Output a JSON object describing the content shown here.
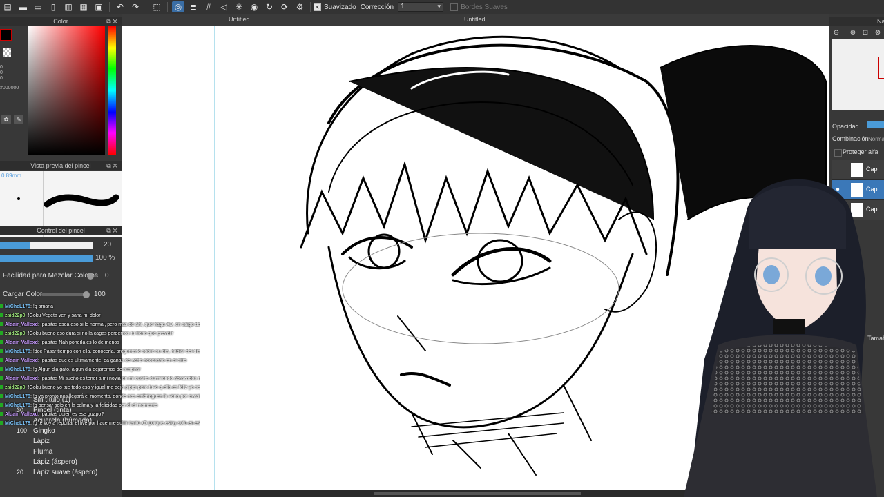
{
  "toolbar": {
    "smoothing_label": "Suavizado",
    "correction_label": "Corrección",
    "correction_value": "1",
    "soft_edges_label": "Bordes Suaves"
  },
  "tabs": {
    "left": "Untitled",
    "right": "Untitled"
  },
  "color_panel": {
    "title": "Color",
    "hex_value": "#000000",
    "channel_values": [
      "0",
      "0",
      "0"
    ],
    "fg_color": "#000000",
    "accent_color": "#cc0000"
  },
  "brush_preview": {
    "title": "Vista previa del pincel",
    "size": "0.89mm"
  },
  "brush_control": {
    "title": "Control del pincel",
    "size_value": "20",
    "opacity_value": "100 %",
    "size_fraction": 0.32,
    "opacity_fraction": 1.0,
    "mix_label": "Facilidad para Mezclar Colores",
    "mix_value": "0",
    "load_label": "Cargar Color",
    "load_value": "100"
  },
  "brush_list": [
    {
      "num": "",
      "label": "Sin título (1)"
    },
    {
      "num": "30",
      "label": "Pincel (tinta)"
    },
    {
      "num": "",
      "label": "Acuarela (húmeda)"
    },
    {
      "num": "100",
      "label": "Gingko"
    },
    {
      "num": "",
      "label": "Lápiz"
    },
    {
      "num": "",
      "label": "Pluma"
    },
    {
      "num": "",
      "label": "Lápiz (áspero)"
    },
    {
      "num": "20",
      "label": "Lápiz suave (áspero)"
    }
  ],
  "chat": [
    {
      "user": "MiCheL178",
      "color": "#7ec8ff",
      "text": ": !g amarla"
    },
    {
      "user": "zaid22p0",
      "color": "#9be07a",
      "text": ": !Goku Vegeta ven y sana mi dolor"
    },
    {
      "user": "Aldair_Vallexd",
      "color": "#c89bff",
      "text": ": !papitas osea eso si lo normal, pero mas de ahi, que haga XD, en salgo de mi casa por huevon p"
    },
    {
      "user": "zaid22p0",
      "color": "#9be07a",
      "text": ": !Goku bueno eso dura si no la cagas perdemos tu tiene que prevalir"
    },
    {
      "user": "Aldair_Vallexd",
      "color": "#c89bff",
      "text": ": !papitas Nah ponerla es lo de menos"
    },
    {
      "user": "MiCheL178",
      "color": "#7ec8ff",
      "text": ": !doc Pasar tiempo con ella, conocerla, preguntarle sobre su dia, hablar del dia a dia, invitarla a salir al cine, parque, a comer, ver series juntos, cocinar juntos asi se queme la casa"
    },
    {
      "user": "Aldair_Vallexd",
      "color": "#c89bff",
      "text": ": !papitas que es ultimamente, da ganas de verte necesario en el sitio"
    },
    {
      "user": "MiCheL178",
      "color": "#7ec8ff",
      "text": ": !g Algun dia gato, algun dia dejaremos de suspirar"
    },
    {
      "user": "Aldair_Vallexd",
      "color": "#c89bff",
      "text": ": !papitas Mi sueño es tener a mi novia en mi cuarto durmiendo abrazados mientras yo hago tarea en mi brazo sin tener que pensar en el tiempo actual"
    },
    {
      "user": "zaid22p0",
      "color": "#9be07a",
      "text": ": !Goku bueno yo tue todo eso y igual me dejo pipipi pero tuve q ella es feliz yo soy feliz"
    },
    {
      "user": "MiCheL178",
      "color": "#7ec8ff",
      "text": ": !g ya pronto nos llegará el momento, donde nos embriaguen la vena por evasión de impuestos"
    },
    {
      "user": "MiCheL178",
      "color": "#7ec8ff",
      "text": ": !g pensar solo en la calma y la felicidad por él el momento"
    },
    {
      "user": "Aldair_Vallexd",
      "color": "#c89bff",
      "text": ": !papitas quien es ese guapo?"
    },
    {
      "user": "MiCheL178",
      "color": "#7ec8ff",
      "text": ": !g te voy a reportar el live por hacerme sufrir tanto xD porque estoy solo en estragada xD"
    }
  ],
  "right_panel": {
    "navigator_title": "Na",
    "opacity_label": "Opacidad",
    "blend_label": "Combinación",
    "blend_value": "Norma",
    "protect_alpha_label": "Proteger alfa",
    "layers": [
      {
        "name": "Cap",
        "selected": false
      },
      {
        "name": "Cap",
        "selected": true
      },
      {
        "name": "Cap",
        "selected": false
      }
    ],
    "size_label": "Tamaño"
  }
}
